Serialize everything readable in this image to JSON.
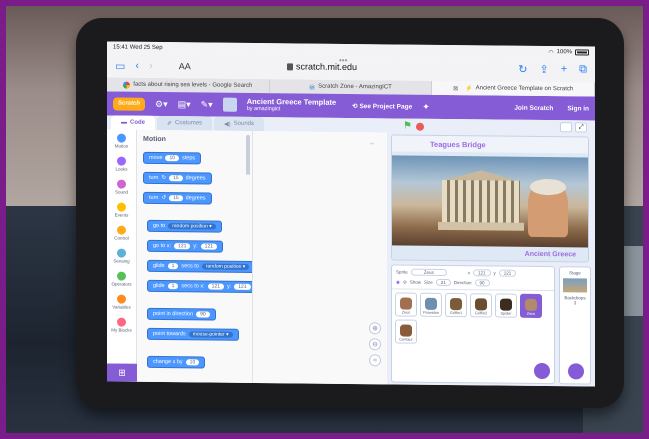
{
  "status_bar": {
    "time": "15:41",
    "date": "Wed 25 Sep",
    "battery": "100%"
  },
  "safari": {
    "aa": "AA",
    "url": "scratch.mit.edu"
  },
  "browser_tabs": [
    {
      "label": "facts about rising sea levels - Google Search",
      "active": false
    },
    {
      "label": "Scratch Zone - AmazingICT",
      "active": false
    },
    {
      "label": "Ancient Greece Template on Scratch",
      "active": true
    }
  ],
  "menubar": {
    "logo": "Scratch",
    "project_title": "Ancient Greece Template",
    "project_by": "by amazingict",
    "see_project_page": "See Project Page",
    "join": "Join Scratch",
    "sign_in": "Sign in"
  },
  "editor_tabs": [
    {
      "label": "Code",
      "active": true
    },
    {
      "label": "Costumes",
      "active": false
    },
    {
      "label": "Sounds",
      "active": false
    }
  ],
  "categories": [
    {
      "label": "Motion",
      "color": "#4c97ff"
    },
    {
      "label": "Looks",
      "color": "#9966ff"
    },
    {
      "label": "Sound",
      "color": "#cf63cf"
    },
    {
      "label": "Events",
      "color": "#ffbf00"
    },
    {
      "label": "Control",
      "color": "#ffab19"
    },
    {
      "label": "Sensing",
      "color": "#5cb1d6"
    },
    {
      "label": "Operators",
      "color": "#59c059"
    },
    {
      "label": "Variables",
      "color": "#ff8c1a"
    },
    {
      "label": "My Blocks",
      "color": "#ff6680"
    }
  ],
  "palette": {
    "title": "Motion",
    "blocks": {
      "move": {
        "a": "move",
        "v": "10",
        "b": "steps"
      },
      "turn_right": {
        "a": "turn",
        "v": "15",
        "b": "degrees"
      },
      "turn_left": {
        "a": "turn",
        "v": "15",
        "b": "degrees"
      },
      "goto": {
        "a": "go to",
        "d": "random position"
      },
      "gotoxy": {
        "a": "go to x:",
        "x": "121",
        "ylbl": "y:",
        "y": "121"
      },
      "glide_to": {
        "a": "glide",
        "v": "1",
        "b": "secs to",
        "d": "random position"
      },
      "glide_xy": {
        "a": "glide",
        "v": "1",
        "b": "secs to x:",
        "x": "121",
        "ylbl": "y:",
        "y": "121"
      },
      "direction": {
        "a": "point in direction",
        "v": "90"
      },
      "towards": {
        "a": "point towards",
        "d": "mouse-pointer"
      },
      "changex": {
        "a": "change x by",
        "v": "10"
      }
    }
  },
  "stage": {
    "title": "Teagues Bridge",
    "subtitle": "Ancient Greece"
  },
  "sprite_info": {
    "sprite_label": "Sprite",
    "sprite_name": "Zeus",
    "x_label": "x",
    "x": "121",
    "y_label": "y",
    "y": "121",
    "show_label": "Show",
    "size_label": "Size",
    "size": "21",
    "direction_label": "Direction",
    "direction": "90"
  },
  "sprites": [
    {
      "name": "Zeus",
      "color": "#a07050",
      "selected": false
    },
    {
      "name": "Poseidon",
      "color": "#6f8fb0",
      "selected": false
    },
    {
      "name": "Griffin1",
      "color": "#7a5b3a",
      "selected": false
    },
    {
      "name": "Griffin2",
      "color": "#6b4e30",
      "selected": false
    },
    {
      "name": "Spider",
      "color": "#3a2d20",
      "selected": false
    },
    {
      "name": "Zeus",
      "color": "#b08a6a",
      "selected": true
    },
    {
      "name": "Centaur",
      "color": "#8a5a3a",
      "selected": false
    }
  ],
  "stage_pane": {
    "label": "Stage",
    "backdrops_label": "Backdrops",
    "backdrops_count": "3"
  }
}
